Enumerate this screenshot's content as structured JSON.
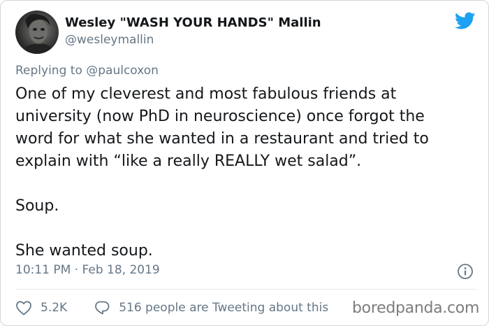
{
  "tweet": {
    "display_name": "Wesley \"WASH YOUR HANDS\" Mallin",
    "handle": "@wesleymallin",
    "reply_prefix": "Replying to",
    "reply_to": "@paulcoxon",
    "paragraphs": [
      [
        "One of my cleverest and most fabulous friends at",
        "university (now PhD in neuroscience) once forgot the",
        "word for what she wanted in a restaurant and tried to",
        "explain with “like a really REALLY wet salad”."
      ],
      [
        "Soup."
      ],
      [
        "She wanted soup."
      ]
    ],
    "timestamp": "10:11 PM · Feb 18, 2019",
    "likes": "5.2K",
    "conversation": "516 people are Tweeting about this"
  },
  "icons": {
    "brand": "twitter-bird-icon",
    "info": "info-icon",
    "like": "heart-icon",
    "reply": "speech-bubble-icon"
  },
  "colors": {
    "twitter_blue": "#1da1f2",
    "text": "#14171a",
    "muted": "#657786",
    "border": "#e1e8ed"
  },
  "watermark": "boredpanda.com"
}
